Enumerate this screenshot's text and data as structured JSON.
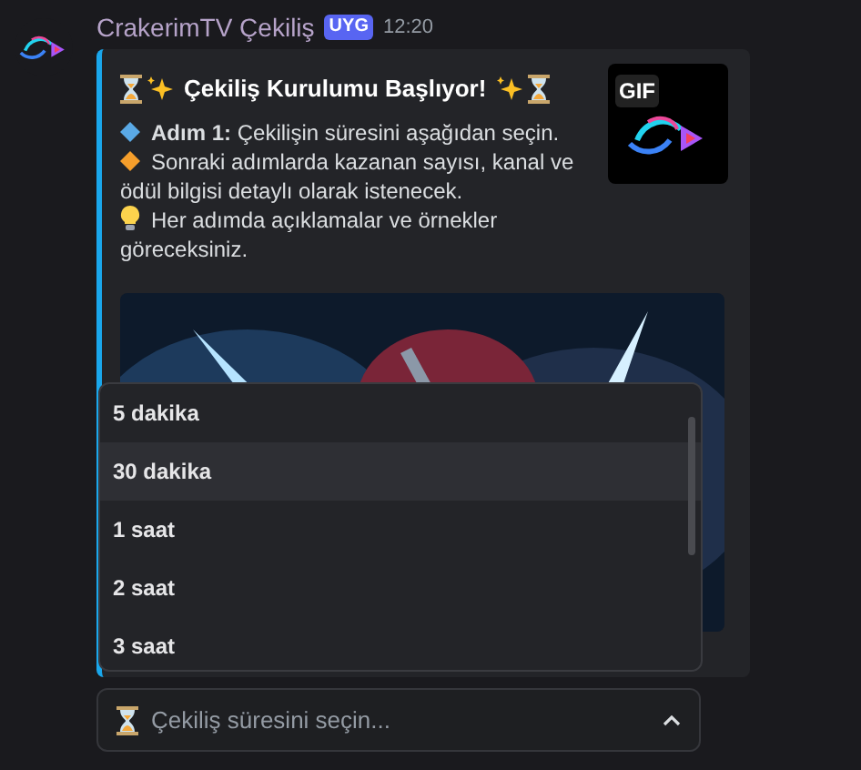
{
  "message": {
    "author": "CrakerimTV Çekiliş",
    "badge": "UYG",
    "time": "12:20"
  },
  "embed": {
    "title": "Çekiliş Kurulumu Başlıyor!",
    "thumbnail_label": "GIF",
    "lines": [
      {
        "kind": "blue-diamond",
        "text": "**Adım 1:** Çekilişin süresini aşağıdan seçin."
      },
      {
        "kind": "orange-diamond",
        "text": "Sonraki adımlarda kazanan sayısı, kanal ve ödül bilgisi detaylı olarak istenecek."
      },
      {
        "kind": "bulb",
        "text": "Her adımda açıklamalar ve örnekler göreceksiniz."
      }
    ]
  },
  "dropdown": {
    "options": [
      {
        "label": "5 dakika",
        "selected": false
      },
      {
        "label": "30 dakika",
        "selected": true
      },
      {
        "label": "1 saat",
        "selected": false
      },
      {
        "label": "2 saat",
        "selected": false
      },
      {
        "label": "3 saat",
        "selected": false
      }
    ]
  },
  "select": {
    "placeholder": "Çekiliş süresini seçin...",
    "expanded": true
  }
}
